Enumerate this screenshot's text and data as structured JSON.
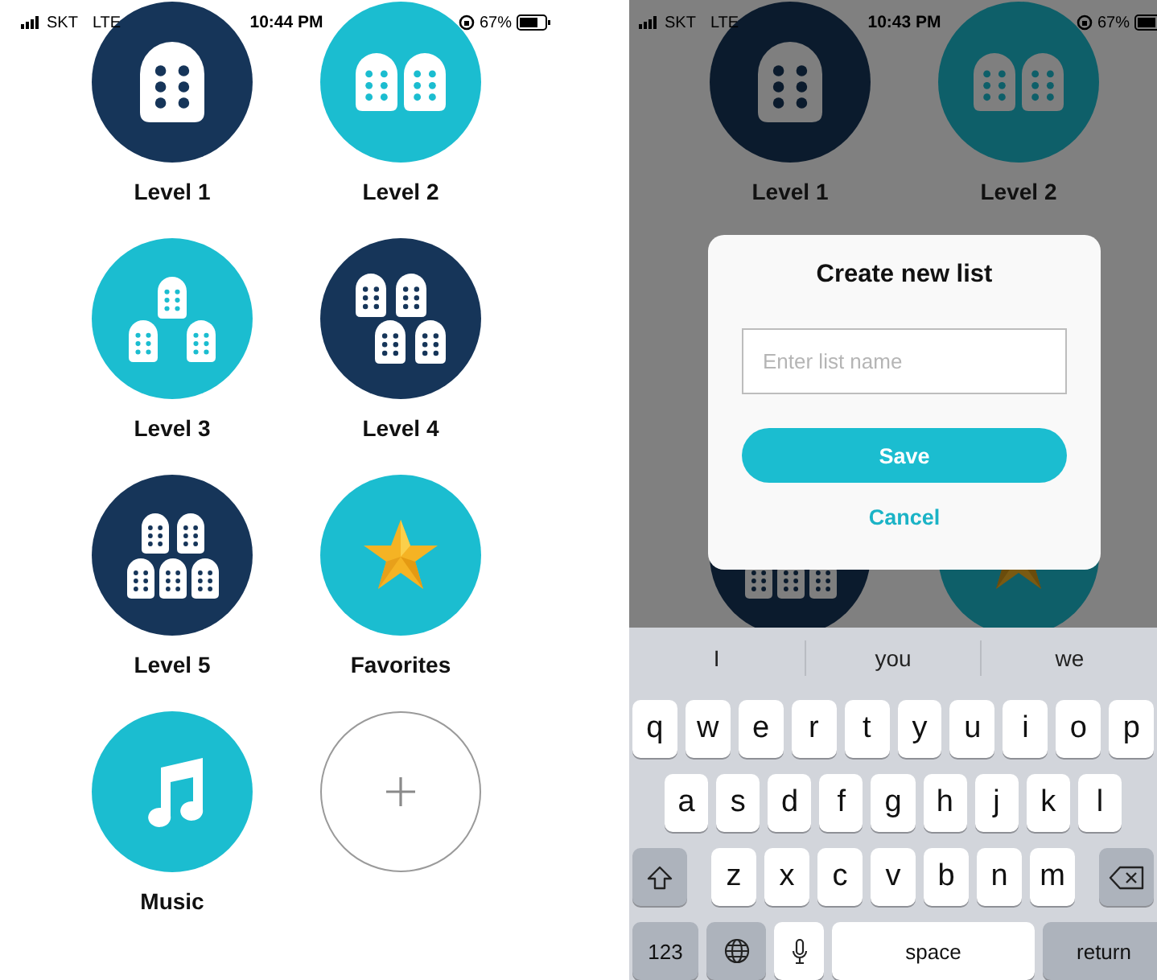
{
  "home_screen": {
    "dimmed": false,
    "status_bar": {
      "carrier": "SKT",
      "network": "LTE",
      "time": "10:44 PM",
      "battery": "67%"
    },
    "tiles": [
      {
        "kind": "one-tablet",
        "label": "Level 1",
        "color": "#163559"
      },
      {
        "kind": "two-tablets",
        "label": "Level 2",
        "color": "#1bbdd0"
      },
      {
        "kind": "three-tablets",
        "label": "Level 3",
        "color": "#1bbdd0"
      },
      {
        "kind": "four-tablets",
        "label": "Level 4",
        "color": "#163559"
      },
      {
        "kind": "five-tablets",
        "label": "Level 5",
        "color": "#163559"
      },
      {
        "kind": "star",
        "label": "Favorites",
        "color": "#1bbdd0"
      },
      {
        "kind": "music",
        "label": "Music",
        "color": "#1bbdd0"
      },
      {
        "kind": "add"
      }
    ]
  },
  "dialog_screen": {
    "dimmed": true,
    "status_bar": {
      "carrier": "SKT",
      "network": "LTE",
      "time": "10:43 PM",
      "battery": "67%"
    },
    "tiles_top": [
      {
        "kind": "one-tablet",
        "label": "Level 1",
        "color": "#0b1b2d"
      },
      {
        "kind": "two-tablets",
        "label": "Level 2",
        "color": "#0e5f69"
      }
    ],
    "tiles_behind": [
      {
        "kind": "five-tablets",
        "color": "#0b1b2d"
      },
      {
        "kind": "star",
        "color": "#0e5f69"
      }
    ],
    "dialog": {
      "title": "Create new list",
      "name_field": {
        "placeholder": "Enter list name"
      },
      "save_button": "Save",
      "cancel_button": "Cancel"
    },
    "keyboard": {
      "suggestions": [
        "I",
        "you",
        "we"
      ],
      "rows": [
        {
          "keys": [
            {
              "kind": "letter",
              "label": "q"
            },
            {
              "kind": "letter",
              "label": "w"
            },
            {
              "kind": "letter",
              "label": "e"
            },
            {
              "kind": "letter",
              "label": "r"
            },
            {
              "kind": "letter",
              "label": "t"
            },
            {
              "kind": "letter",
              "label": "y"
            },
            {
              "kind": "letter",
              "label": "u"
            },
            {
              "kind": "letter",
              "label": "i"
            },
            {
              "kind": "letter",
              "label": "o"
            },
            {
              "kind": "letter",
              "label": "p"
            }
          ]
        },
        {
          "keys": [
            {
              "kind": "letter",
              "label": "a"
            },
            {
              "kind": "letter",
              "label": "s"
            },
            {
              "kind": "letter",
              "label": "d"
            },
            {
              "kind": "letter",
              "label": "f"
            },
            {
              "kind": "letter",
              "label": "g"
            },
            {
              "kind": "letter",
              "label": "h"
            },
            {
              "kind": "letter",
              "label": "j"
            },
            {
              "kind": "letter",
              "label": "k"
            },
            {
              "kind": "letter",
              "label": "l"
            }
          ]
        },
        {
          "keys": [
            {
              "kind": "shift"
            },
            {
              "kind": "letter",
              "label": "z"
            },
            {
              "kind": "letter",
              "label": "x"
            },
            {
              "kind": "letter",
              "label": "c"
            },
            {
              "kind": "letter",
              "label": "v"
            },
            {
              "kind": "letter",
              "label": "b"
            },
            {
              "kind": "letter",
              "label": "n"
            },
            {
              "kind": "letter",
              "label": "m"
            },
            {
              "kind": "delete"
            }
          ]
        },
        {
          "keys": [
            {
              "kind": "mode",
              "label": "123"
            },
            {
              "kind": "globe"
            },
            {
              "kind": "mic"
            },
            {
              "kind": "space",
              "label": "space"
            },
            {
              "kind": "return",
              "label": "return"
            }
          ]
        }
      ]
    }
  }
}
